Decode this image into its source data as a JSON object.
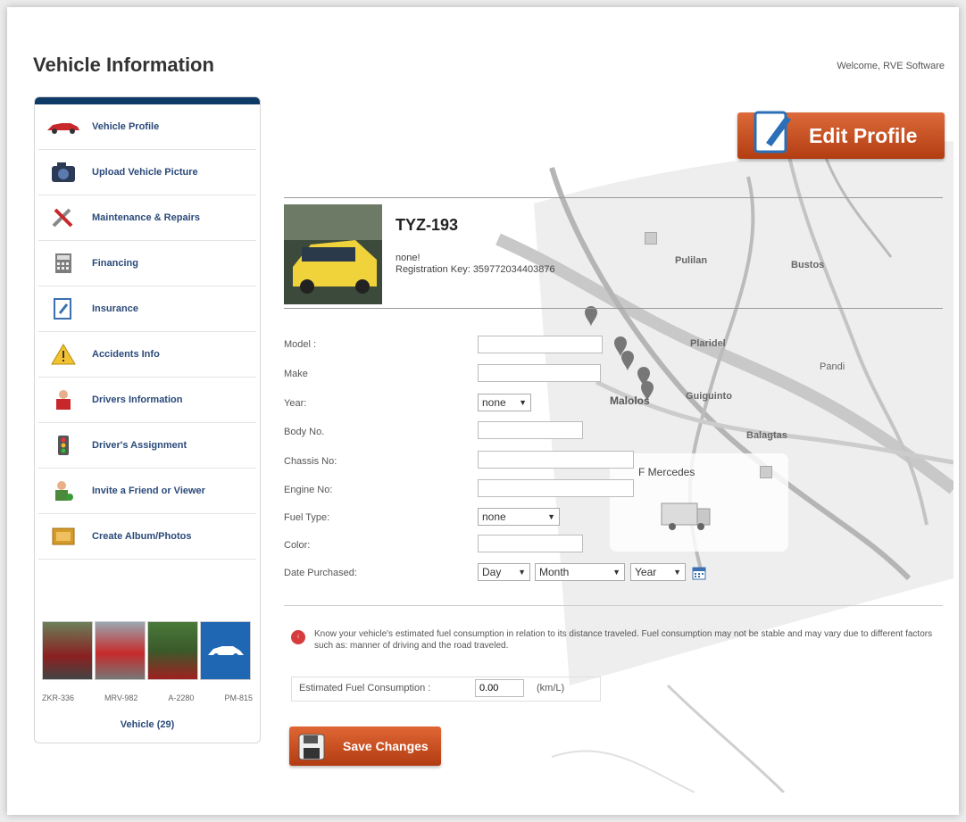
{
  "header": {
    "title": "Vehicle Information",
    "welcome": "Welcome, RVE Software"
  },
  "sidebar": {
    "items": [
      {
        "label": "Vehicle Profile",
        "icon": "red-car-icon"
      },
      {
        "label": "Upload Vehicle Picture",
        "icon": "camera-icon"
      },
      {
        "label": "Maintenance & Repairs",
        "icon": "tools-icon"
      },
      {
        "label": "Financing",
        "icon": "calculator-icon"
      },
      {
        "label": "Insurance",
        "icon": "insurance-document-icon"
      },
      {
        "label": "Accidents Info",
        "icon": "warning-icon"
      },
      {
        "label": "Drivers Information",
        "icon": "driver-icon"
      },
      {
        "label": "Driver's Assignment",
        "icon": "traffic-light-icon"
      },
      {
        "label": "Invite a Friend or Viewer",
        "icon": "person-plus-icon"
      },
      {
        "label": "Create Album/Photos",
        "icon": "album-icon"
      }
    ],
    "thumbnails": [
      "ZKR-336",
      "MRV-982",
      "A-2280",
      "PM-815"
    ],
    "vehicle_count": "Vehicle (29)"
  },
  "edit_button": {
    "label": "Edit Profile"
  },
  "profile": {
    "plate": "TYZ-193",
    "line1": "none!",
    "line2": "Registration Key: 359772034403876"
  },
  "map": {
    "places": [
      "Pulilan",
      "Bustos",
      "Plaridel",
      "Pandi",
      "Malolos",
      "Guiguinto",
      "Balagtas"
    ],
    "popup_title": "F Mercedes"
  },
  "form": {
    "model_label": "Model :",
    "make_label": "Make",
    "year_label": "Year:",
    "year_value": "none",
    "body_label": "Body No.",
    "chassis_label": "Chassis No:",
    "engine_label": "Engine No:",
    "fuel_label": "Fuel Type:",
    "fuel_value": "none",
    "color_label": "Color:",
    "date_label": "Date Purchased:",
    "day_value": "Day",
    "month_value": "Month",
    "year_sel_value": "Year"
  },
  "fuel_info": {
    "text": "Know your vehicle's estimated fuel consumption in relation to its distance traveled. Fuel consumption may not be stable and may vary due to different factors such as: manner of driving and the road traveled.",
    "label": "Estimated Fuel Consumption :",
    "value": "0.00",
    "unit": "(km/L)"
  },
  "save_button": {
    "label": "Save Changes"
  },
  "colors": {
    "navy": "#0e3a68",
    "orange": "#c24a1c",
    "link": "#2a4a7a"
  }
}
